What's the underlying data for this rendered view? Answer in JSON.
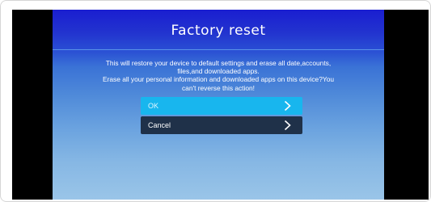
{
  "dialog": {
    "title": "Factory reset",
    "message_lines": [
      "This will restore your device to default settings and erase all date,accounts,",
      "files,and downloaded apps.",
      "Erase all your personal information and downloaded apps on this device?You",
      "can't reverse this action!"
    ],
    "buttons": {
      "ok": {
        "label": "OK",
        "icon": "chevron-right-icon"
      },
      "cancel": {
        "label": "Cancel",
        "icon": "chevron-right-icon"
      }
    }
  },
  "colors": {
    "ok_button": "#18b6ee",
    "cancel_button": "#1f3149",
    "header_blue": "#1a1ed0",
    "bottom_blue": "#9ac5e8",
    "letterbox": "#000000"
  }
}
